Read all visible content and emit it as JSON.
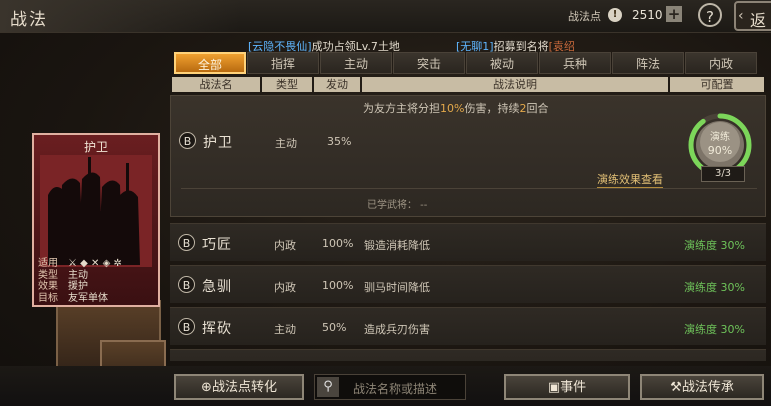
{
  "header": {
    "title": "战法",
    "points_label": "战法点",
    "points_icon": "!",
    "points_value": "2510",
    "plus_label": "+",
    "help_label": "?",
    "back_label": "返"
  },
  "notices": [
    {
      "bracket": "[云隐不畏仙]",
      "text": "成功占领Lv.7土地"
    },
    {
      "bracket": "[无聊1]",
      "text": "招募到名将",
      "tail": "[袁绍"
    }
  ],
  "tabs": [
    "全部",
    "指挥",
    "主动",
    "突击",
    "被动",
    "兵种",
    "阵法",
    "内政"
  ],
  "active_tab": 0,
  "columns": {
    "name": "战法名",
    "type": "类型",
    "trigger": "发动",
    "desc": "战法说明",
    "config": "可配置"
  },
  "expanded": {
    "grade": "B",
    "name": "护卫",
    "type": "主动",
    "trigger": "35%",
    "desc_pre": "为友方主将分担",
    "desc_pct": "10%",
    "desc_mid": "伤害，持续",
    "desc_turns": "2",
    "desc_post": "回合",
    "practice_label": "演练",
    "practice_value": "90%",
    "practice_progress": 0.9,
    "level": "3/3",
    "level_link": "演练效果查看",
    "learned": "已学武将：  --"
  },
  "rows": [
    {
      "grade": "B",
      "name": "巧匠",
      "type": "内政",
      "trigger": "100%",
      "desc": "锻造消耗降低",
      "prof": "演练度 30%"
    },
    {
      "grade": "B",
      "name": "急驯",
      "type": "内政",
      "trigger": "100%",
      "desc": "驯马时间降低",
      "prof": "演练度 30%"
    },
    {
      "grade": "B",
      "name": "挥砍",
      "type": "主动",
      "trigger": "50%",
      "desc": "造成兵刃伤害",
      "prof": "演练度 30%"
    }
  ],
  "card": {
    "title": "护卫",
    "applies_label": "适用",
    "type_label": "类型",
    "type_value": "主动",
    "effect_label": "效果",
    "effect_value": "援护",
    "target_label": "目标",
    "target_value": "友军单体"
  },
  "bottom": {
    "convert_label": "战法点转化",
    "search_placeholder": "战法名称或描述",
    "event_label": "事件",
    "inherit_label": "战法传承"
  },
  "colors": {
    "accent": "#f0a030",
    "green": "#6ec35a",
    "notice_blue": "#5fb6ff"
  }
}
